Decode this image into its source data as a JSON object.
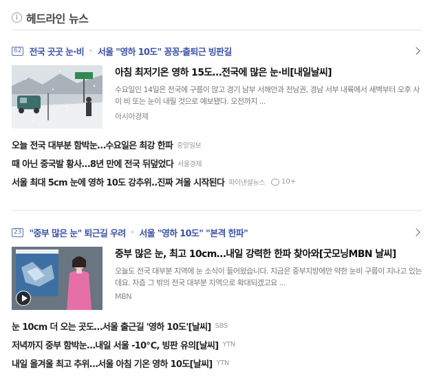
{
  "header": {
    "info_glyph": "i",
    "title": "헤드라인 뉴스"
  },
  "clusters": [
    {
      "count": "62",
      "keywords": [
        "전국 곳곳 눈·비",
        "서울 \"영하 10도\" 꽁꽁·출퇴근 빙판길"
      ],
      "main": {
        "title": "아침 최저기온 영하 15도…전국에 많은 눈·비[내일날씨]",
        "summary": "수요일인 14일은 전국에 구름이 많고 경기 남부 서해안과 전남권, 경남 서부 내륙에서 새벽부터 오후 사이 비 또는 눈이 내릴 것으로 예보됐다. 오전까지 ...",
        "source": "아시아경제",
        "thumb_icon": "snow-scene-photo"
      },
      "subs": [
        {
          "title": "오늘 전국 대부분 함박눈…수요일은 최강 한파",
          "source": "중앙일보"
        },
        {
          "title": "때 아닌 중국발 황사…8년 만에 전국 뒤덮었다",
          "source": "서울경제"
        },
        {
          "title": "서울 최대 5cm 눈에 영하 10도 강추위..진짜 겨울 시작된다",
          "source": "파이낸셜뉴스",
          "comments": "10+"
        }
      ]
    },
    {
      "count": "23",
      "keywords": [
        "\"중부 많은 눈\" 퇴근길 우려",
        "서울 \"영하 10도\" \"본격 한파\""
      ],
      "main": {
        "title": "중부 많은 눈, 최고 10cm…내일 강력한 한파 찾아와[굿모닝MBN 날씨]",
        "summary": "오늘도 전국 대부분 지역에 눈 소식이 들어왔습니다. 지금은 중부지방에만 약한 눈비 구름이 지나고 있는데요. 자츰 그 밖의 전국 대부분 지역으로 확대되겠고요 ...",
        "source": "MBN",
        "thumb_icon": "weather-video-thumbnail"
      },
      "subs": [
        {
          "title": "눈 10cm 더 오는 곳도…서울 출근길 '영하 10도'[날씨]",
          "source": "SBS"
        },
        {
          "title": "저녁까지 중부 함박눈…내일 서울 -10℃, 빙판 유의[날씨]",
          "source": "YTN"
        },
        {
          "title": "내일 올겨울 최고 추위…서울 아침 기온 영하 10도[날씨]",
          "source": "YTN"
        }
      ]
    }
  ],
  "colors": {
    "keyword": "#3d54a8",
    "badge": "#5a6caf"
  }
}
